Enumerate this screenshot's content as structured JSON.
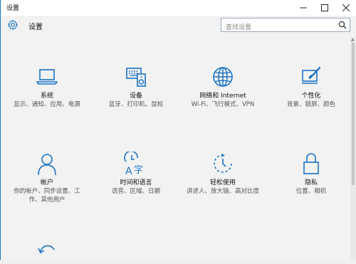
{
  "window": {
    "title": "设置"
  },
  "header": {
    "title": "设置"
  },
  "search": {
    "placeholder": "查找设置"
  },
  "accent": "#1a73c4",
  "tiles": [
    {
      "name": "系统",
      "desc": "显示、通知、应用、电源",
      "icon": "laptop-icon"
    },
    {
      "name": "设备",
      "desc": "蓝牙、打印机、鼠标",
      "icon": "devices-icon"
    },
    {
      "name": "网络和 Internet",
      "desc": "Wi-Fi、飞行模式、VPN",
      "icon": "globe-icon"
    },
    {
      "name": "个性化",
      "desc": "背景、锁屏、颜色",
      "icon": "paint-icon"
    },
    {
      "name": "帐户",
      "desc": "你的帐户、同步设置、工作、其他用户",
      "icon": "person-icon"
    },
    {
      "name": "时间和语言",
      "desc": "语音、区域、日期",
      "icon": "time-language-icon"
    },
    {
      "name": "轻松使用",
      "desc": "讲述人、放大镜、高对比度",
      "icon": "ease-of-access-icon"
    },
    {
      "name": "隐私",
      "desc": "位置、相机",
      "icon": "lock-icon"
    },
    {
      "name": "",
      "desc": "",
      "icon": "update-icon"
    }
  ]
}
